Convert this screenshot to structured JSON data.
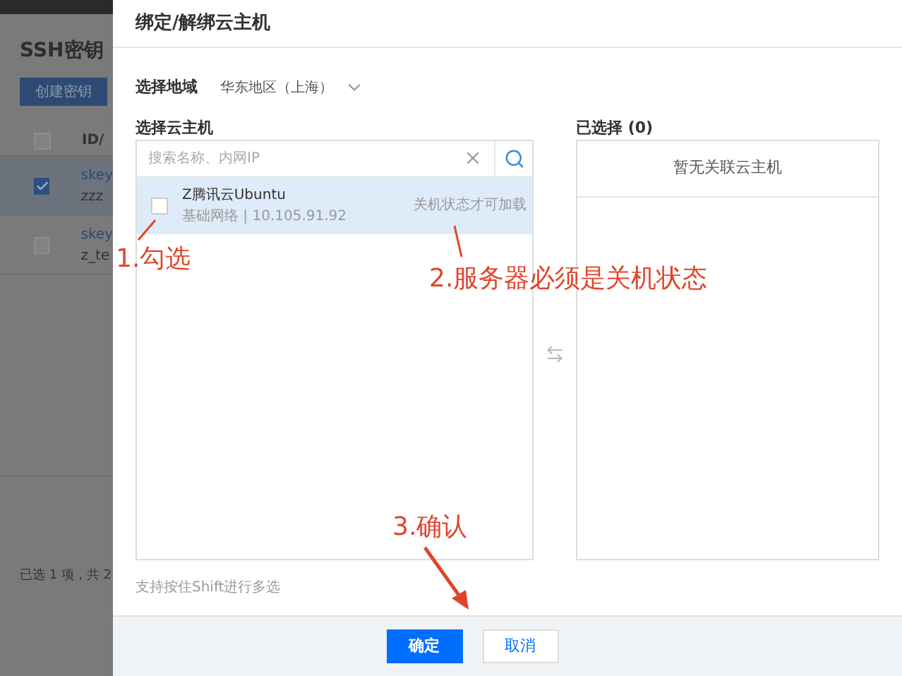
{
  "background_page": {
    "title": "SSH密钥",
    "create_button": "创建密钥",
    "all_checked": false,
    "columns": [
      "ID/"
    ],
    "rows": [
      {
        "selected": true,
        "cells": [
          "skey",
          "zzz"
        ]
      },
      {
        "selected": false,
        "cells": [
          "skey",
          "z_te"
        ]
      }
    ],
    "footer": "已选 1 项，共 2"
  },
  "dialog": {
    "title": "绑定/解绑云主机",
    "region": {
      "label": "选择地域",
      "value": "华东地区（上海）"
    },
    "available": {
      "label": "选择云主机",
      "search": {
        "placeholder": "搜索名称、内网IP"
      },
      "items": [
        {
          "name": "Z腾讯云Ubuntu",
          "detail": "基础网络 | 10.105.91.92",
          "status": "关机状态才可加载",
          "checked": false,
          "selected": true
        }
      ]
    },
    "chosen": {
      "label": "已选择 (0)",
      "empty": "暂无关联云主机"
    },
    "hint": "支持按住Shift进行多选",
    "buttons": [
      {
        "label": "确定",
        "kind": "primary"
      },
      {
        "label": "取消",
        "kind": "secondary"
      }
    ]
  },
  "annotations": [
    "1.勾选",
    "2.服务器必须是关机状态",
    "3.确认"
  ]
}
